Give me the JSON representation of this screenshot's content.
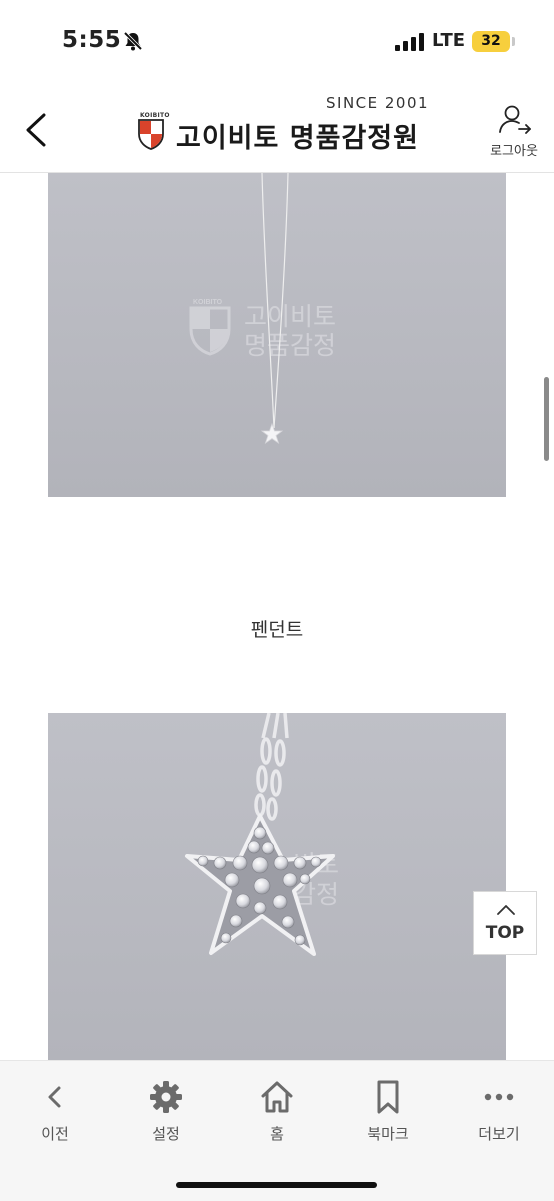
{
  "status_bar": {
    "time": "5:55",
    "network": "LTE",
    "battery": "32",
    "icons": [
      "bell-slash-icon",
      "signal-icon"
    ]
  },
  "header": {
    "since": "SINCE 2001",
    "logo_text": "KOIBITO",
    "brand": "고이비토 명품감정원",
    "logout_label": "로그아웃",
    "icons": [
      "back-chevron-icon",
      "shield-logo-icon",
      "user-logout-icon"
    ]
  },
  "content": {
    "watermark": {
      "logo_text": "KOIBITO",
      "line1": "고이비토",
      "line2": "명품감정"
    },
    "section_caption": "펜던트",
    "photos": [
      "necklace-full-photo",
      "star-pendant-closeup-photo"
    ]
  },
  "top_button": {
    "label": "TOP"
  },
  "toolbar": {
    "items": [
      {
        "label": "이전",
        "icon": "chevron-left-icon"
      },
      {
        "label": "설정",
        "icon": "gear-icon"
      },
      {
        "label": "홈",
        "icon": "home-icon"
      },
      {
        "label": "북마크",
        "icon": "bookmark-icon"
      },
      {
        "label": "더보기",
        "icon": "more-dots-icon"
      }
    ]
  },
  "colors": {
    "photo_background": "#b9bac1",
    "battery": "#f7cf3d",
    "logo_red": "#d9432b",
    "toolbar_background": "#f6f6f6",
    "toolbar_icon": "#6b6b6b"
  }
}
